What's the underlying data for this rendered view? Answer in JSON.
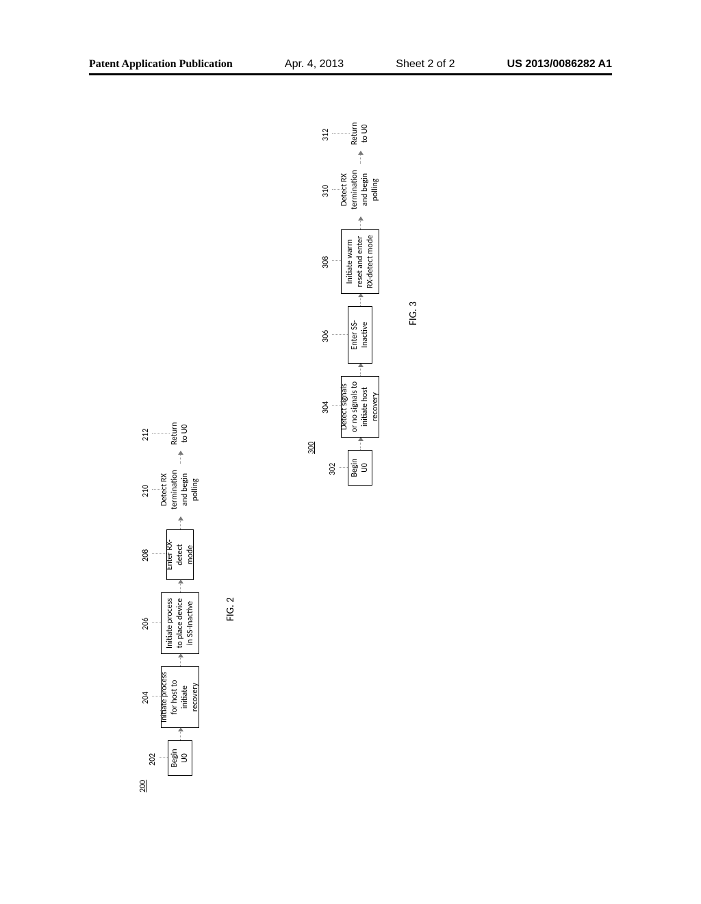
{
  "header": {
    "left": "Patent Application Publication",
    "center_date": "Apr. 4, 2013",
    "center_sheet": "Sheet 2 of 2",
    "right": "US 2013/0086282 A1"
  },
  "fig200": {
    "number": "200",
    "caption": "FIG. 2",
    "steps": [
      {
        "ref": "202",
        "text": "Begin U0"
      },
      {
        "ref": "204",
        "text": "Initiate process for host to initiate recovery"
      },
      {
        "ref": "206",
        "text": "Initiate process to place device in SS-Inactive"
      },
      {
        "ref": "208",
        "text": "Enter RX-detect mode"
      },
      {
        "ref": "210",
        "text": "Detect RX termination and begin polling"
      },
      {
        "ref": "212",
        "text": "Return to U0"
      }
    ]
  },
  "fig300": {
    "number": "300",
    "caption": "FIG. 3",
    "steps": [
      {
        "ref": "302",
        "text": "Begin U0"
      },
      {
        "ref": "304",
        "text": "Detect signals or no signals to initiate host recovery"
      },
      {
        "ref": "306",
        "text": "Enter SS-Inactive"
      },
      {
        "ref": "308",
        "text": "Initiate warm reset and enter RX-detect mode"
      },
      {
        "ref": "310",
        "text": "Detect RX termination and begin polling"
      },
      {
        "ref": "312",
        "text": "Return to U0"
      }
    ]
  }
}
